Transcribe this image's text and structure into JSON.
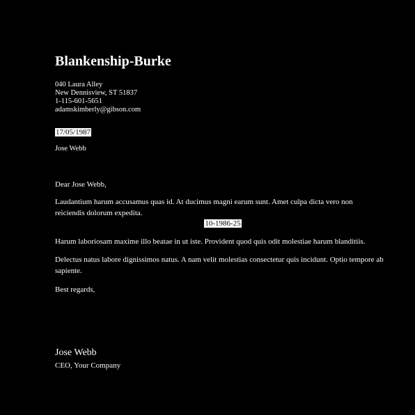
{
  "letterhead": {
    "company": "Blankenship-Burke",
    "address_line1": "040 Laura Alley",
    "address_line2": "New Dennisview, ST 51837",
    "phone": "1-115-601-5651",
    "email": "adamskimberly@gibson.com"
  },
  "date_top": "17/05/1987",
  "recipient": "Jose Webb",
  "salutation": "Dear Jose Webb,",
  "paragraphs": {
    "p1": "Laudantium harum accusamus quas id. At ducimus magni earum sunt. Amet culpa dicta vero non reiciendis dolorum expedita.",
    "p2": "Harum laboriosam maxime illo beatae in ut iste. Provident quod quis odit molestiae harum blanditiis.",
    "p3": "Delectus natus labore dignissimos natus. A nam velit molestias consectetur quis incidunt. Optio tempore ab sapiente."
  },
  "date_middle": "10-1986-25",
  "closing": "Best regards,",
  "signature": {
    "name": "Jose Webb",
    "title": "CEO, Your Company"
  },
  "colors": {
    "background": "#000000",
    "text": "#ffffff",
    "highlight": "#ffffff"
  }
}
